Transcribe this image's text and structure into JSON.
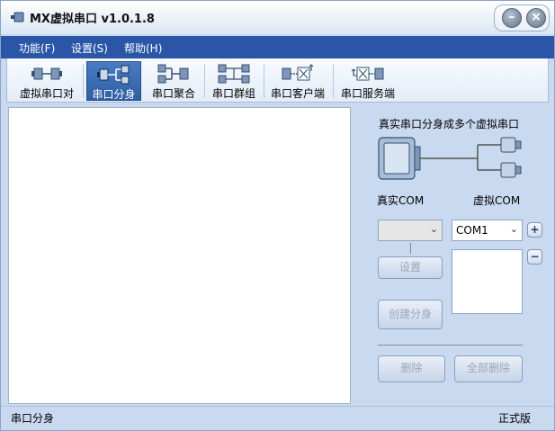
{
  "window": {
    "title": "MX虚拟串口  v1.0.1.8"
  },
  "menu": {
    "items": [
      "功能(F)",
      "设置(S)",
      "帮助(H)"
    ]
  },
  "toolbar": {
    "items": [
      {
        "label": "虚拟串口对",
        "icon": "port-pair-icon",
        "active": false
      },
      {
        "label": "串口分身",
        "icon": "port-split-icon",
        "active": true
      },
      {
        "label": "串口聚合",
        "icon": "port-aggregate-icon",
        "active": false
      },
      {
        "label": "串口群组",
        "icon": "port-group-icon",
        "active": false
      },
      {
        "label": "串口客户端",
        "icon": "port-client-icon",
        "active": false
      },
      {
        "label": "串口服务端",
        "icon": "port-server-icon",
        "active": false
      }
    ]
  },
  "right_panel": {
    "diagram_caption": "真实串口分身成多个虚拟串口",
    "real_com_label": "真实COM",
    "virtual_com_label": "虚拟COM",
    "source_combo_value": "",
    "com_combo_value": "COM1",
    "add_label": "+",
    "remove_label": "−",
    "setup_label": "设置",
    "create_label": "创建分身",
    "delete_label": "删除",
    "delete_all_label": "全部删除"
  },
  "status": {
    "left": "串口分身",
    "right": "正式版"
  },
  "colors": {
    "menu_bg": "#2b56a8",
    "window_bg": "#c9d9ef",
    "active_tool": "#2f5fa3"
  }
}
